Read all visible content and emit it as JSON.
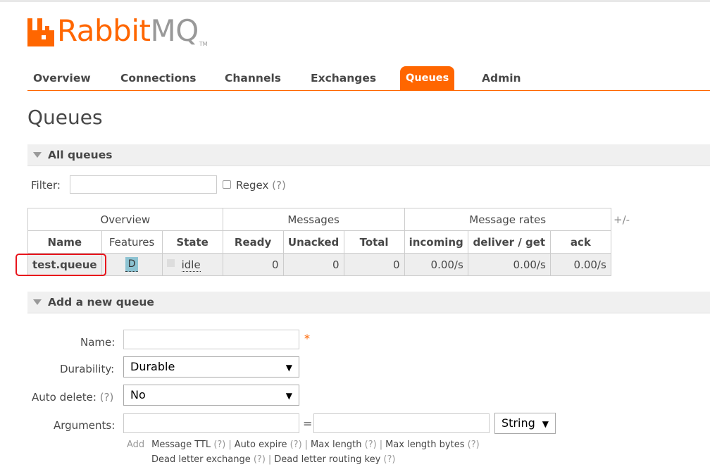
{
  "logo": {
    "rabbit": "Rabbit",
    "mq": "MQ",
    "tm": "TM",
    "brand_color": "#ff6600",
    "icon": "rabbitmq-logo-icon"
  },
  "nav": {
    "tabs": [
      {
        "label": "Overview"
      },
      {
        "label": "Connections"
      },
      {
        "label": "Channels"
      },
      {
        "label": "Exchanges"
      },
      {
        "label": "Queues",
        "active": true
      },
      {
        "label": "Admin"
      }
    ]
  },
  "page": {
    "title": "Queues"
  },
  "all_queues": {
    "heading": "All queues",
    "filter_label": "Filter:",
    "filter_value": "",
    "regex_label": "Regex",
    "regex_help": "(?)",
    "plus_minus": "+/-",
    "table": {
      "groups": [
        "Overview",
        "Messages",
        "Message rates"
      ],
      "columns": [
        "Name",
        "Features",
        "State",
        "Ready",
        "Unacked",
        "Total",
        "incoming",
        "deliver / get",
        "ack"
      ],
      "rows": [
        {
          "name": "test.queue",
          "features": "D",
          "state": "idle",
          "ready": "0",
          "unacked": "0",
          "total": "0",
          "incoming": "0.00/s",
          "deliver_get": "0.00/s",
          "ack": "0.00/s"
        }
      ]
    }
  },
  "add_queue": {
    "heading": "Add a new queue",
    "name_label": "Name:",
    "name_value": "",
    "required_mark": "*",
    "durability_label": "Durability:",
    "durability_value": "Durable",
    "auto_delete_label": "Auto delete:",
    "auto_delete_help": "(?)",
    "auto_delete_value": "No",
    "arguments_label": "Arguments:",
    "equals": "=",
    "arg_type_value": "String",
    "add_label": "Add",
    "shortcuts_line1": [
      {
        "label": "Message TTL",
        "help": "(?)"
      },
      {
        "label": "Auto expire",
        "help": "(?)"
      },
      {
        "label": "Max length",
        "help": "(?)"
      },
      {
        "label": "Max length bytes",
        "help": "(?)"
      }
    ],
    "shortcuts_line2": [
      {
        "label": "Dead letter exchange",
        "help": "(?)"
      },
      {
        "label": "Dead letter routing key",
        "help": "(?)"
      }
    ],
    "separator": "|"
  }
}
